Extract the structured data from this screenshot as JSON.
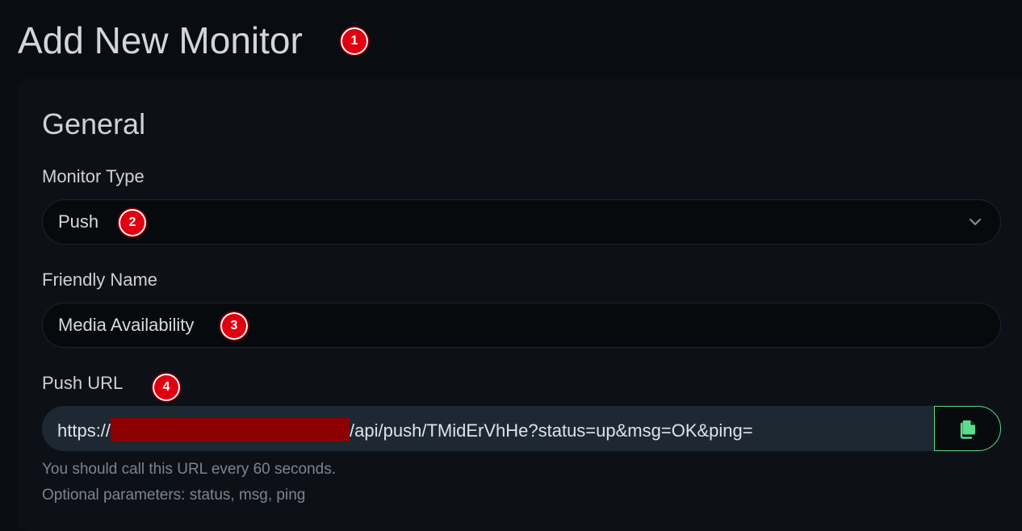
{
  "page": {
    "title": "Add New Monitor"
  },
  "annotations": [
    "1",
    "2",
    "3",
    "4"
  ],
  "general": {
    "section_title": "General",
    "monitor_type": {
      "label": "Monitor Type",
      "value": "Push"
    },
    "friendly_name": {
      "label": "Friendly Name",
      "value": "Media Availability"
    },
    "push_url": {
      "label": "Push URL",
      "prefix": "https://",
      "suffix": "/api/push/TMidErVhHe?status=up&msg=OK&ping=",
      "help_interval": "You should call this URL every 60 seconds.",
      "help_params": "Optional parameters: status, msg, ping"
    }
  },
  "colors": {
    "background": "#090c10",
    "card": "#0d1117",
    "accent": "#5cdd8b",
    "badge": "#e30613",
    "redaction": "#8b0000"
  },
  "icons": {
    "dropdown": "chevron-down-icon",
    "copy": "copy-icon"
  }
}
